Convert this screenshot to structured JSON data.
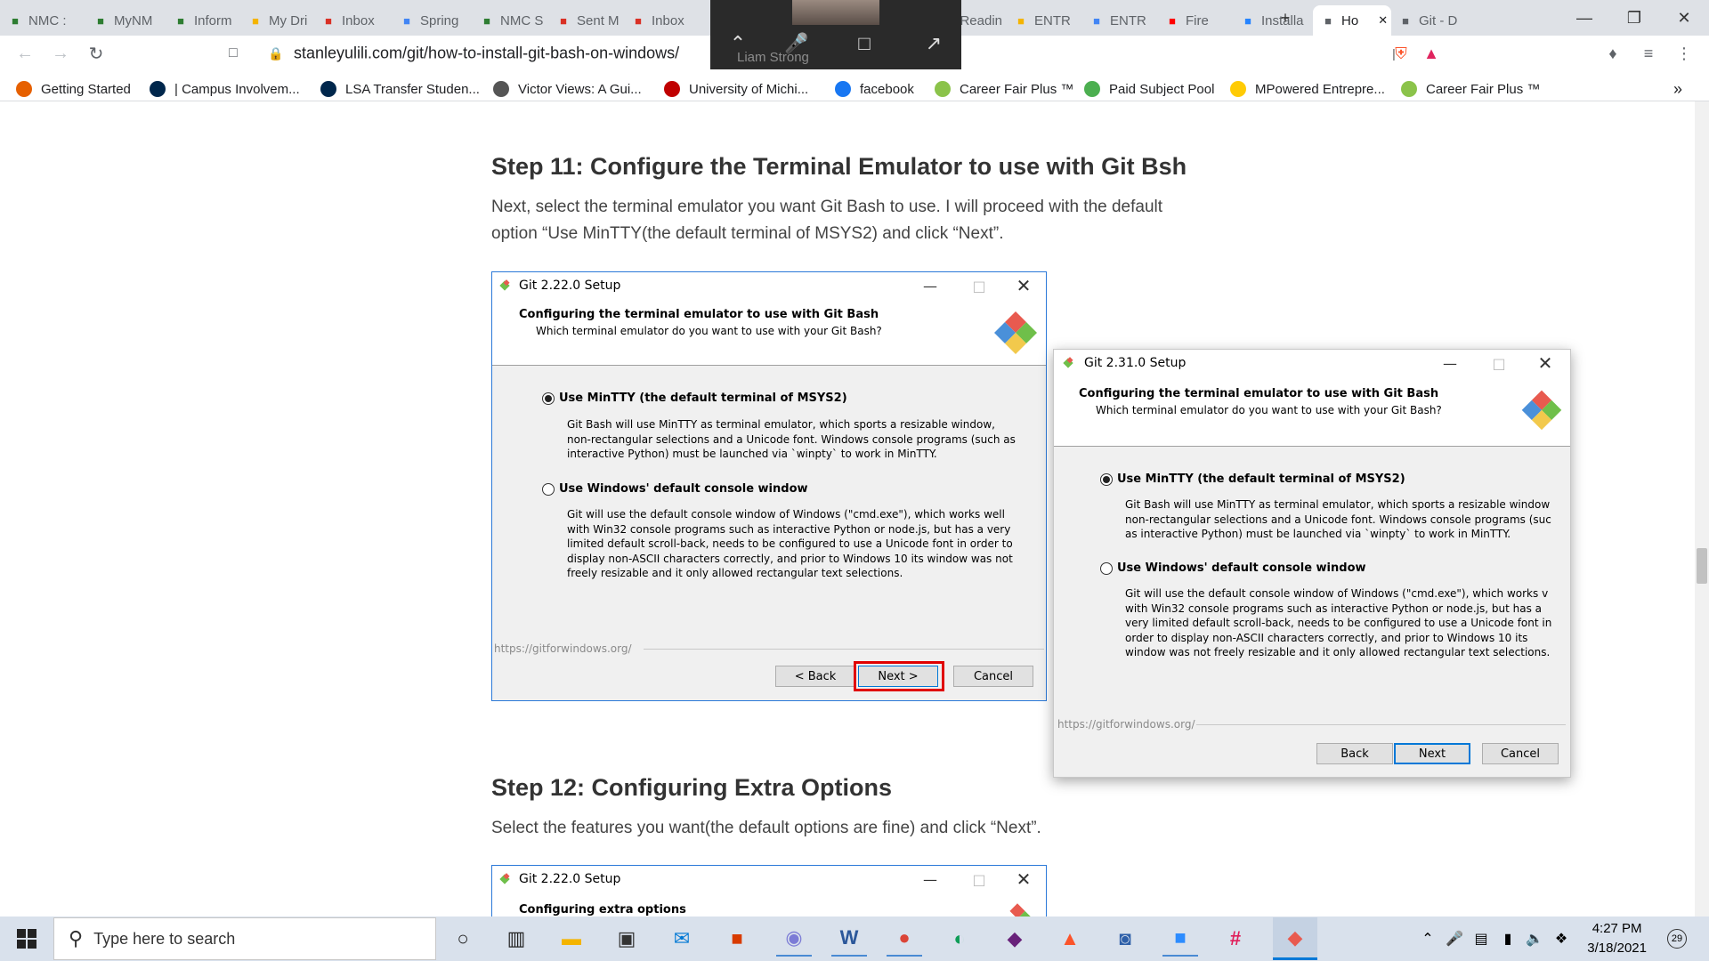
{
  "browser": {
    "tabs": [
      {
        "label": "NMC :",
        "icon": "nmc-icon",
        "color": "#2e7d32"
      },
      {
        "label": "MyNM",
        "icon": "nmc-icon",
        "color": "#2e7d32"
      },
      {
        "label": "Inform",
        "icon": "nmc-icon",
        "color": "#2e7d32"
      },
      {
        "label": "My Dri",
        "icon": "google-drive-icon",
        "color": "#f4b400"
      },
      {
        "label": "Inbox",
        "icon": "gmail-icon",
        "color": "#d93025"
      },
      {
        "label": "Spring",
        "icon": "google-docs-icon",
        "color": "#4285f4"
      },
      {
        "label": "NMC S",
        "icon": "nmc-icon",
        "color": "#2e7d32"
      },
      {
        "label": "Sent M",
        "icon": "gmail-icon",
        "color": "#d93025"
      },
      {
        "label": "Inbox",
        "icon": "gmail-icon",
        "color": "#d93025"
      },
      {
        "label": "Readin",
        "icon": "page-icon",
        "color": "#888888"
      },
      {
        "label": "ENTR",
        "icon": "google-drive-icon",
        "color": "#f4b400"
      },
      {
        "label": "ENTR",
        "icon": "google-docs-icon",
        "color": "#4285f4"
      },
      {
        "label": "Fire",
        "icon": "youtube-icon",
        "color": "#ff0000"
      },
      {
        "label": "Installa",
        "icon": "confluence-icon",
        "color": "#2684ff"
      },
      {
        "label": "Ho",
        "icon": "globe-icon",
        "color": "#5f6368",
        "active": true
      },
      {
        "label": "Git - D",
        "icon": "globe-icon",
        "color": "#5f6368"
      }
    ],
    "url": "stanleyulili.com/git/how-to-install-git-bash-on-windows/",
    "bookmarks": [
      {
        "label": "Getting Started",
        "color": "#e66000"
      },
      {
        "label": "| Campus Involvem...",
        "color": "#00274c"
      },
      {
        "label": "LSA Transfer Studen...",
        "color": "#00274c"
      },
      {
        "label": "Victor Views: A Gui...",
        "color": "#555555"
      },
      {
        "label": "University of Michi...",
        "color": "#c00000"
      },
      {
        "label": "facebook",
        "color": "#1877f2"
      },
      {
        "label": "Career Fair Plus ™",
        "color": "#8bc34a"
      },
      {
        "label": "Paid Subject Pool",
        "color": "#4caf50"
      },
      {
        "label": "MPowered Entrepre...",
        "color": "#ffcb05"
      },
      {
        "label": "Career Fair Plus ™",
        "color": "#8bc34a"
      }
    ],
    "overflow": "»"
  },
  "meet_overlay": {
    "name": "Liam Strong"
  },
  "article": {
    "step11_title": "Step 11: Configure the Terminal Emulator to use with Git Bsh",
    "step11_text": "Next, select the terminal emulator you want Git Bash to use. I will proceed with the default option “Use MinTTY(the default terminal of MSYS2) and click “Next”.",
    "step12_title": "Step 12: Configuring Extra Options",
    "step12_text": "Select the features you want(the default options are fine) and click “Next”."
  },
  "dialog_a": {
    "title": "Git 2.22.0 Setup",
    "header_title": "Configuring the terminal emulator to use with Git Bash",
    "header_sub": "Which terminal emulator do you want to use with your Git Bash?",
    "opt1_label": "Use MinTTY (the default terminal of MSYS2)",
    "opt1_desc": "Git Bash will use MinTTY as terminal emulator, which sports a resizable window, non-rectangular selections and a Unicode font. Windows console programs (such as interactive Python) must be launched via `winpty` to work in MinTTY.",
    "opt2_label": "Use Windows' default console window",
    "opt2_desc": "Git will use the default console window of Windows (\"cmd.exe\"), which works well with Win32 console programs such as interactive Python or node.js, but has a very limited default scroll-back, needs to be configured to use a Unicode font in order to display non-ASCII characters correctly, and prior to Windows 10 its window was not freely resizable and it only allowed rectangular text selections.",
    "footer_link": "https://gitforwindows.org/",
    "back": "< Back",
    "next": "Next >",
    "cancel": "Cancel"
  },
  "dialog_b": {
    "title": "Git 2.31.0 Setup",
    "header_title": "Configuring the terminal emulator to use with Git Bash",
    "header_sub": "Which terminal emulator do you want to use with your Git Bash?",
    "opt1_label": "Use MinTTY (the default terminal of MSYS2)",
    "opt1_desc": "Git Bash will use MinTTY as terminal emulator, which sports a resizable window non-rectangular selections and a Unicode font. Windows console programs (suc as interactive Python) must be launched via `winpty` to work in MinTTY.",
    "opt2_label": "Use Windows' default console window",
    "opt2_desc": "Git will use the default console window of Windows (\"cmd.exe\"), which works v with Win32 console programs such as interactive Python or node.js, but has a very limited default scroll-back, needs to be configured to use a Unicode font in order to display non-ASCII characters correctly, and prior to Windows 10 its window was not freely resizable and it only allowed rectangular text selections.",
    "footer_link": "https://gitforwindows.org/",
    "back": "Back",
    "next": "Next",
    "cancel": "Cancel"
  },
  "dialog_c": {
    "title": "Git 2.22.0 Setup",
    "header_title": "Configuring extra options"
  },
  "taskbar": {
    "search_placeholder": "Type here to search",
    "time": "4:27 PM",
    "date": "3/18/2021",
    "notification_count": "29",
    "apps": [
      "cortana-icon",
      "task-view-icon",
      "file-explorer-icon",
      "store-icon",
      "mail-icon",
      "office-icon",
      "zoom-meetings-icon",
      "word-icon",
      "chrome-icon",
      "edge-icon",
      "visual-studio-icon",
      "brave-icon",
      "onedrive-icon",
      "zoom-icon",
      "slack-icon",
      "git-icon"
    ]
  }
}
